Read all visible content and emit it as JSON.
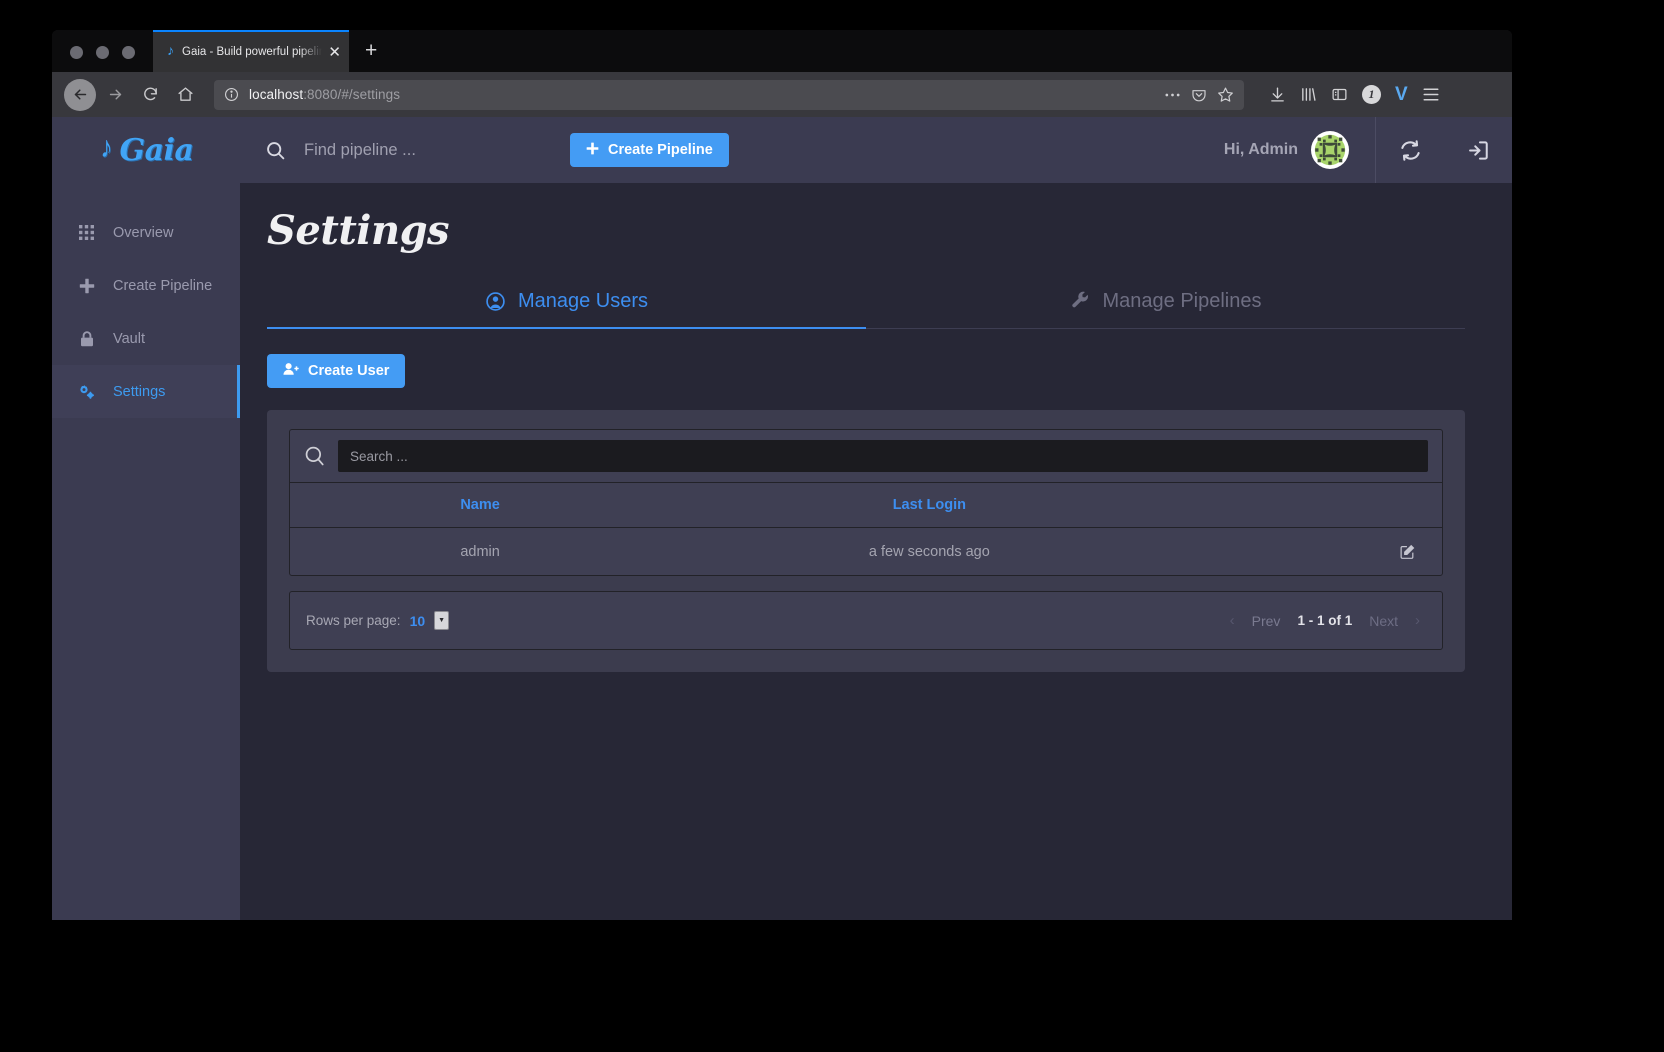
{
  "browser": {
    "tab": {
      "title": "Gaia - Build powerful pipelines in any programming language.",
      "favicon": "gaia-note-icon",
      "close": "✕"
    },
    "new_tab": "+",
    "url_host": "localhost",
    "url_rest": ":8080/#/settings",
    "toolbar_icons": [
      "download-icon",
      "library-icon",
      "sidebar-icon",
      "account-icon",
      "vivaldi-icon",
      "menu-icon"
    ],
    "account_badge": "1",
    "vivaldi_badge": "V"
  },
  "sidebar": {
    "brand": "Gaia",
    "items": [
      {
        "label": "Overview",
        "icon": "grid-icon",
        "active": false
      },
      {
        "label": "Create Pipeline",
        "icon": "plus-icon",
        "active": false
      },
      {
        "label": "Vault",
        "icon": "lock-icon",
        "active": false
      },
      {
        "label": "Settings",
        "icon": "gears-icon",
        "active": true
      }
    ]
  },
  "topbar": {
    "search_placeholder": "Find pipeline ...",
    "search_value": "",
    "create_pipeline_label": "Create Pipeline",
    "greeting": "Hi, Admin",
    "avatar": "identicon-avatar",
    "refresh_icon": "refresh-icon",
    "logout_icon": "logout-icon"
  },
  "page": {
    "title": "Settings",
    "tabs": [
      {
        "label": "Manage Users",
        "icon": "user-circle-icon",
        "active": true
      },
      {
        "label": "Manage Pipelines",
        "icon": "wrench-icon",
        "active": false
      }
    ],
    "create_user_label": "Create User"
  },
  "table": {
    "search_placeholder": "Search ...",
    "search_value": "",
    "columns": [
      "Name",
      "Last Login",
      ""
    ],
    "rows": [
      {
        "name": "admin",
        "last_login": "a few seconds ago",
        "action_icon": "edit-icon"
      }
    ]
  },
  "pagination": {
    "rows_per_page_label": "Rows per page:",
    "rows_per_page_value": "10",
    "prev_label": "Prev",
    "range_label": "1 - 1 of 1",
    "next_label": "Next",
    "prev_arrow": "‹",
    "next_arrow": "›"
  },
  "colors": {
    "accent": "#3d8ef0",
    "button": "#449cf4",
    "sidebar_bg": "#3b3b51",
    "content_bg": "#272736",
    "card_bg": "#3c3c4e"
  }
}
